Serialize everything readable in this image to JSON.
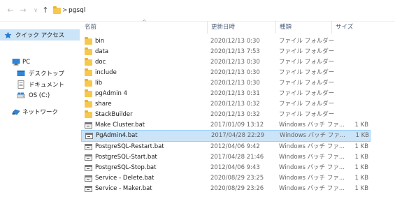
{
  "address": {
    "path": [
      "pgsql"
    ],
    "separator": ">"
  },
  "nav": {
    "items": [
      {
        "label": "クイック アクセス",
        "icon": "star-icon",
        "selected": true
      },
      {
        "label": "PC",
        "icon": "pc-icon",
        "selected": false
      },
      {
        "label": "デスクトップ",
        "icon": "desktop-icon",
        "selected": false
      },
      {
        "label": "ドキュメント",
        "icon": "documents-icon",
        "selected": false
      },
      {
        "label": "OS (C:)",
        "icon": "drive-icon",
        "selected": false
      },
      {
        "label": "ネットワーク",
        "icon": "network-icon",
        "selected": false
      }
    ]
  },
  "columns": {
    "name": "名前",
    "date": "更新日時",
    "type": "種類",
    "size": "サイズ"
  },
  "files": [
    {
      "name": "bin",
      "date": "2020/12/13 0:30",
      "type": "ファイル フォルダー",
      "size": "",
      "kind": "folder"
    },
    {
      "name": "data",
      "date": "2020/12/13 7:53",
      "type": "ファイル フォルダー",
      "size": "",
      "kind": "folder"
    },
    {
      "name": "doc",
      "date": "2020/12/13 0:30",
      "type": "ファイル フォルダー",
      "size": "",
      "kind": "folder"
    },
    {
      "name": "include",
      "date": "2020/12/13 0:30",
      "type": "ファイル フォルダー",
      "size": "",
      "kind": "folder"
    },
    {
      "name": "lib",
      "date": "2020/12/13 0:30",
      "type": "ファイル フォルダー",
      "size": "",
      "kind": "folder"
    },
    {
      "name": "pgAdmin 4",
      "date": "2020/12/13 0:31",
      "type": "ファイル フォルダー",
      "size": "",
      "kind": "folder"
    },
    {
      "name": "share",
      "date": "2020/12/13 0:32",
      "type": "ファイル フォルダー",
      "size": "",
      "kind": "folder"
    },
    {
      "name": "StackBuilder",
      "date": "2020/12/13 0:32",
      "type": "ファイル フォルダー",
      "size": "",
      "kind": "folder"
    },
    {
      "name": "Make Cluster.bat",
      "date": "2017/01/09 13:12",
      "type": "Windows バッチ ファ...",
      "size": "1 KB",
      "kind": "bat"
    },
    {
      "name": "PgAdmin4.bat",
      "date": "2017/04/28 22:29",
      "type": "Windows バッチ ファ...",
      "size": "1 KB",
      "kind": "bat",
      "selected": true
    },
    {
      "name": "PostgreSQL-Restart.bat",
      "date": "2012/04/06 9:42",
      "type": "Windows バッチ ファ...",
      "size": "1 KB",
      "kind": "bat"
    },
    {
      "name": "PostgreSQL-Start.bat",
      "date": "2017/04/28 21:46",
      "type": "Windows バッチ ファ...",
      "size": "1 KB",
      "kind": "bat"
    },
    {
      "name": "PostgreSQL-Stop.bat",
      "date": "2012/04/06 9:43",
      "type": "Windows バッチ ファ...",
      "size": "1 KB",
      "kind": "bat"
    },
    {
      "name": "Service - Delete.bat",
      "date": "2020/08/29 23:25",
      "type": "Windows バッチ ファ...",
      "size": "1 KB",
      "kind": "bat"
    },
    {
      "name": "Service - Maker.bat",
      "date": "2020/08/29 23:26",
      "type": "Windows バッチ ファ...",
      "size": "1 KB",
      "kind": "bat"
    }
  ]
}
